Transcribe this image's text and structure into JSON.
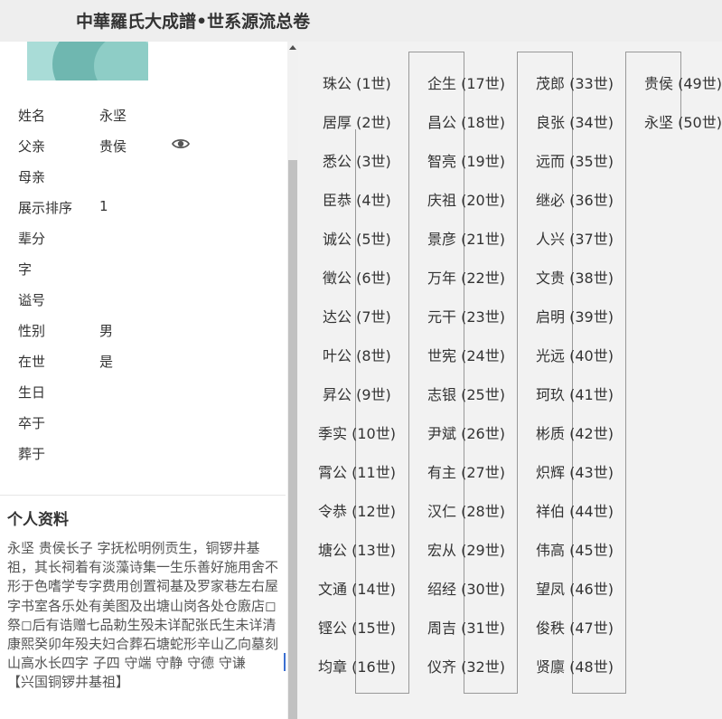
{
  "header": {
    "title": "中華羅氏大成譜•世系源流总卷"
  },
  "profile": {
    "fields": [
      {
        "label": "姓名",
        "value": "永坚"
      },
      {
        "label": "父亲",
        "value": "贵侯"
      },
      {
        "label": "母亲",
        "value": ""
      },
      {
        "label": "展示排序",
        "value": "1"
      },
      {
        "label": "辈分",
        "value": ""
      },
      {
        "label": "字",
        "value": ""
      },
      {
        "label": "谥号",
        "value": ""
      },
      {
        "label": "性别",
        "value": "男"
      },
      {
        "label": "在世",
        "value": "是"
      },
      {
        "label": "生日",
        "value": ""
      },
      {
        "label": "卒于",
        "value": ""
      },
      {
        "label": "葬于",
        "value": ""
      }
    ],
    "father_view_icon": "eye-icon"
  },
  "details": {
    "heading": "个人资料",
    "bio": "永坚 贵侯长子 字抚松明例贡生，铜锣井基祖，其长祠着有淡藻诗集一生乐善好施用舍不形于色嗜学专字费用创置祠基及罗家巷左右屋字书室各乐处有美图及出塘山岗各处仓廒店◻祭◻后有诰赠七品勅生殁未详配张氏生未详清康熙癸卯年殁夫妇合葬石塘蛇形辛山乙向墓刻山高水长四字 子四 守端 守静 守德 守谦",
    "origin": "【兴国铜锣井基祖】"
  },
  "lineage": [
    "珠公 (1世)",
    "居厚 (2世)",
    "悉公 (3世)",
    "臣恭 (4世)",
    "诚公 (5世)",
    "徵公 (6世)",
    "达公 (7世)",
    "叶公 (8世)",
    "昇公 (9世)",
    "季实 (10世)",
    "霄公 (11世)",
    "令恭 (12世)",
    "塘公 (13世)",
    "文通 (14世)",
    "铿公 (15世)",
    "均章 (16世)",
    "企生 (17世)",
    "昌公 (18世)",
    "智亮 (19世)",
    "庆祖 (20世)",
    "景彦 (21世)",
    "万年 (22世)",
    "元干 (23世)",
    "世宪 (24世)",
    "志银 (25世)",
    "尹斌 (26世)",
    "有主 (27世)",
    "汉仁 (28世)",
    "宏从 (29世)",
    "绍经 (30世)",
    "周吉 (31世)",
    "仪齐 (32世)",
    "茂郎 (33世)",
    "良张 (34世)",
    "远而 (35世)",
    "继必 (36世)",
    "人兴 (37世)",
    "文贵 (38世)",
    "启明 (39世)",
    "光远 (40世)",
    "珂玖 (41世)",
    "彬质 (42世)",
    "炽辉 (43世)",
    "祥伯 (44世)",
    "伟高 (45世)",
    "望凤 (46世)",
    "俊秩 (47世)",
    "贤廪 (48世)",
    "贵侯 (49世)",
    "永坚 (50世)"
  ]
}
